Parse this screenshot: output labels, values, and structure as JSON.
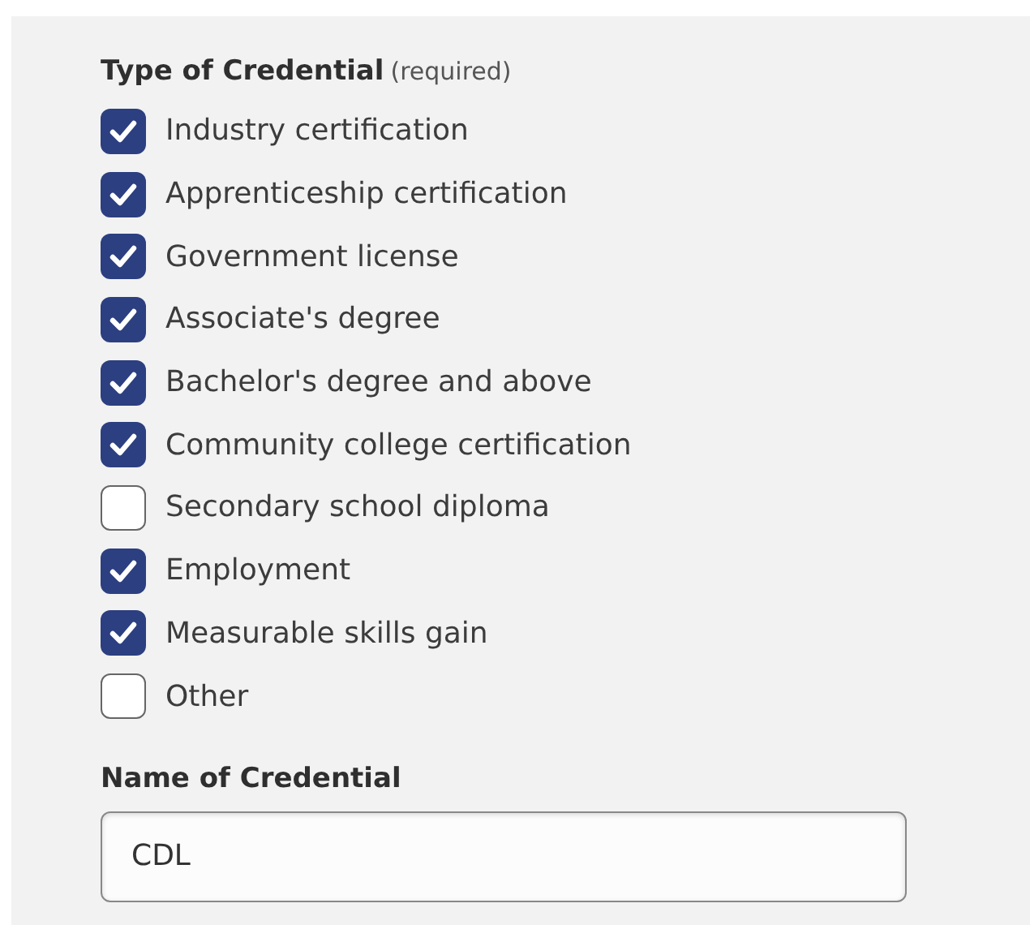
{
  "credential_type": {
    "label": "Type of Credential",
    "note": "(required)",
    "options": [
      {
        "label": "Industry certification",
        "checked": true
      },
      {
        "label": "Apprenticeship certification",
        "checked": true
      },
      {
        "label": "Government license",
        "checked": true
      },
      {
        "label": "Associate's degree",
        "checked": true
      },
      {
        "label": "Bachelor's degree and above",
        "checked": true
      },
      {
        "label": "Community college certification",
        "checked": true
      },
      {
        "label": "Secondary school diploma",
        "checked": false
      },
      {
        "label": "Employment",
        "checked": true
      },
      {
        "label": "Measurable skills gain",
        "checked": true
      },
      {
        "label": "Other",
        "checked": false
      }
    ]
  },
  "credential_name": {
    "label": "Name of Credential",
    "value": "CDL"
  }
}
